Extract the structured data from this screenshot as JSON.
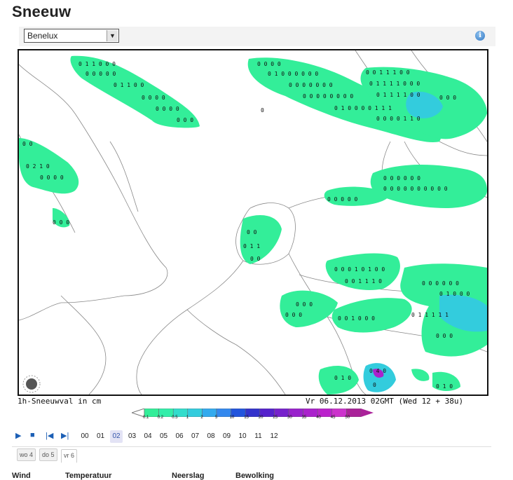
{
  "page": {
    "title": "Sneeuw"
  },
  "region": {
    "selected": "Benelux"
  },
  "map": {
    "caption_left": "1h-Sneeuwval in cm",
    "caption_right": "Vr 06.12.2013 02GMT (Wed 12 + 38u)",
    "legend_labels": [
      "0.1",
      "0.2",
      "0.5",
      "1",
      "2",
      "5",
      "10",
      "15",
      "20",
      "25",
      "30",
      "35",
      "40",
      "45",
      "50"
    ],
    "legend_colors": [
      "#33ee99",
      "#33eeaa",
      "#33ddcc",
      "#33ccdd",
      "#33aaee",
      "#3388ee",
      "#2255dd",
      "#3333cc",
      "#5522cc",
      "#7722cc",
      "#9922cc",
      "#aa22cc",
      "#bb22cc",
      "#cc33cc",
      "#aa2299"
    ],
    "colors": {
      "snow_light": "#33ee99",
      "snow_mid": "#33ccdd",
      "snow_heavy": "#3399ee",
      "snow_peak": "#aa22cc"
    }
  },
  "timeline": {
    "hours": [
      "00",
      "01",
      "02",
      "03",
      "04",
      "05",
      "06",
      "07",
      "08",
      "09",
      "10",
      "11",
      "12"
    ],
    "active_hour": "02",
    "days": [
      "wo 4",
      "do 5",
      "vr 6"
    ],
    "active_day": "vr 6"
  },
  "bottom_tabs": [
    "Wind",
    "Temperatuur",
    "Neerslag",
    "Bewolking"
  ]
}
